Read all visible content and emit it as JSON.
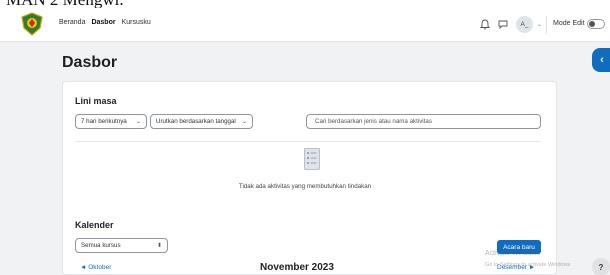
{
  "doc_fragment": "MAN 2 Mengwi.",
  "navbar": {
    "logo": "school-crest",
    "links": [
      {
        "label": "Beranda",
        "active": false
      },
      {
        "label": "Dasbor",
        "active": true
      },
      {
        "label": "Kursusku",
        "active": false
      }
    ],
    "avatar_initials": "A_",
    "edit_mode_label": "Mode Edit"
  },
  "page_title": "Dasbor",
  "timeline": {
    "heading": "Lini masa",
    "filter_value": "7 hari berikutnya",
    "sort_value": "Urutkan berdasarkan tanggal",
    "search_placeholder": "Cari berdasarkan jenis atau nama aktivitas",
    "empty_message": "Tidak ada aktivitas yang membutuhkan tindakan"
  },
  "calendar": {
    "heading": "Kalender",
    "course_filter": "Semua kursus",
    "new_event_label": "Acara baru",
    "prev_month": "Oktober",
    "current_month": "November 2023",
    "next_month": "Desember"
  },
  "watermark": {
    "line1": "Activate Windows",
    "line2": "Go to Settings to activate Windows"
  },
  "help_label": "?",
  "drawer_toggle_label": "‹",
  "colors": {
    "accent": "#0f6cbf",
    "page_bg": "#f1f2f4"
  }
}
